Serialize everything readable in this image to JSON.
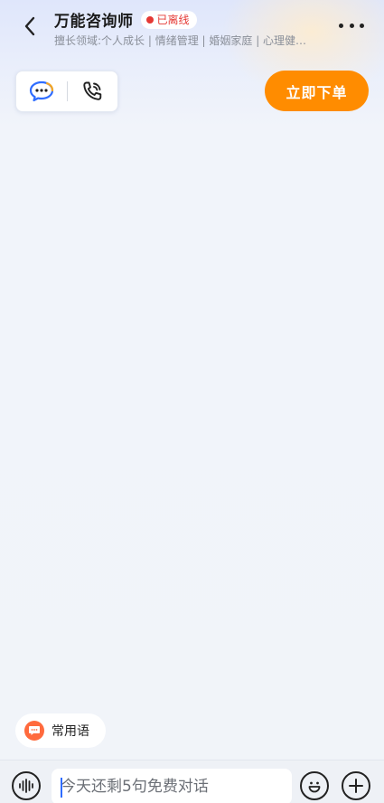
{
  "header": {
    "title": "万能咨询师",
    "status": "已离线",
    "subtitle": "擅长领域:个人成长 | 情绪管理 | 婚姻家庭 | 心理健…"
  },
  "contact": {
    "message_icon": "chat-bubble-icon",
    "phone_icon": "phone-icon"
  },
  "order_button": "立即下单",
  "quick_phrases": "常用语",
  "input": {
    "placeholder": "今天还剩5句免费对话"
  },
  "icons": {
    "back": "chevron-left-icon",
    "more": "more-dots-icon",
    "voice": "voice-wave-icon",
    "emoji": "emoji-icon",
    "plus": "plus-icon"
  },
  "colors": {
    "accent": "#ff8c00",
    "offline": "#e53935",
    "brand_blue": "#2f6dff",
    "phrase_icon": "#ff6a3d"
  }
}
